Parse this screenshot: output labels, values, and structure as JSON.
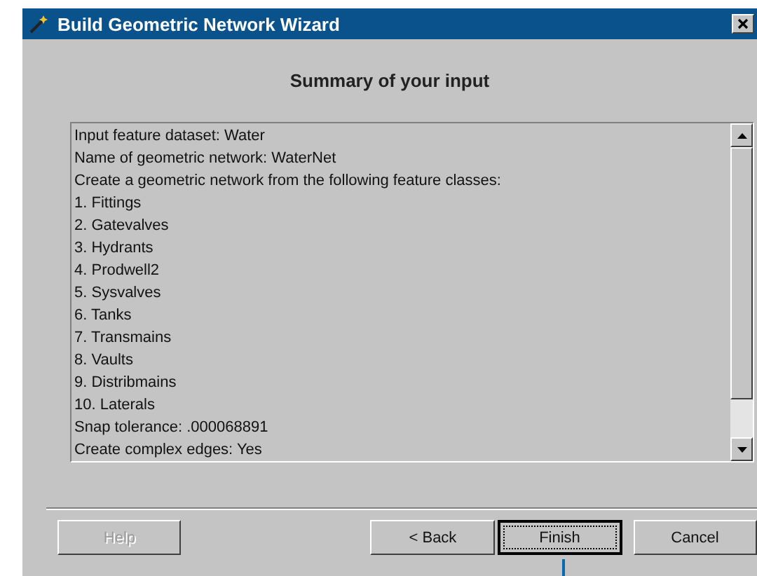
{
  "window": {
    "title": "Build Geometric Network Wizard"
  },
  "heading": "Summary of your input",
  "summary_lines": [
    "Input feature dataset: Water",
    "Name of geometric network: WaterNet",
    "Create a geometric network from the following feature classes:",
    "1. Fittings",
    "2. Gatevalves",
    "3. Hydrants",
    "4. Prodwell2",
    "5. Sysvalves",
    "6. Tanks",
    "7. Transmains",
    "8. Vaults",
    "9. Distribmains",
    "10. Laterals",
    "Snap tolerance: .000068891",
    "Create complex edges: Yes"
  ],
  "buttons": [
    {
      "label": "Help",
      "disabled": true,
      "default": false
    },
    {
      "label": "< Back",
      "disabled": false,
      "default": false
    },
    {
      "label": "Finish",
      "disabled": false,
      "default": true
    },
    {
      "label": "Cancel",
      "disabled": false,
      "default": false
    }
  ]
}
